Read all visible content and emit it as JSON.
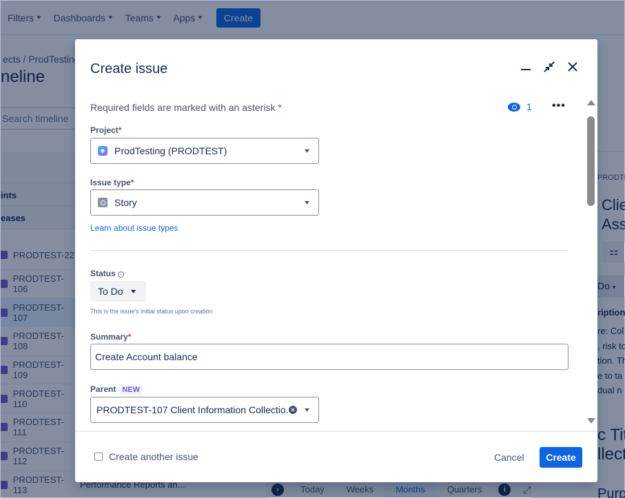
{
  "topnav": {
    "items": [
      {
        "label": "Filters"
      },
      {
        "label": "Dashboards"
      },
      {
        "label": "Teams"
      },
      {
        "label": "Apps"
      }
    ],
    "create_label": "Create"
  },
  "background": {
    "breadcrumb": "ects  /  ProdTesting",
    "page_title": "neline",
    "search_placeholder": "Search timeline",
    "sprints_label": "ints",
    "releases_label": "eases",
    "issues": [
      {
        "key": "PRODTEST-22"
      },
      {
        "key": "PRODTEST-106"
      },
      {
        "key": "PRODTEST-107"
      },
      {
        "key": "PRODTEST-108"
      },
      {
        "key": "PRODTEST-109"
      },
      {
        "key": "PRODTEST-110"
      },
      {
        "key": "PRODTEST-111"
      },
      {
        "key": "PRODTEST-112"
      },
      {
        "key": "PRODTEST-113"
      }
    ],
    "last_issue_title": "Performance Reports an...",
    "timeline_toolbar": {
      "today": "Today",
      "weeks": "Weeks",
      "months": "Months",
      "quarters": "Quarters",
      "active": "Months"
    },
    "detail_panel": {
      "key": "PRODTEST",
      "title_line1": "Clie",
      "title_line2": "Ass",
      "status": "Do",
      "description_label": "ription",
      "description_lines": [
        "re: Col",
        ", risk to",
        "tion. Th",
        "e to ta",
        "dual n"
      ],
      "heading_line1": "c Tit",
      "heading_line2": "llect",
      "purpose": "Purpose"
    }
  },
  "modal": {
    "title": "Create issue",
    "required_note": "Required fields are marked with an asterisk",
    "watchers_count": "1",
    "fields": {
      "project": {
        "label": "Project",
        "value": "ProdTesting (PRODTEST)"
      },
      "issue_type": {
        "label": "Issue type",
        "value": "Story",
        "help_link": "Learn about issue types"
      },
      "status": {
        "label": "Status",
        "value": "To Do",
        "help": "This is the issue's initial status upon creation"
      },
      "summary": {
        "label": "Summary",
        "value": "Create Account balance"
      },
      "parent": {
        "label": "Parent",
        "badge": "NEW",
        "value": "PRODTEST-107 Client Information Collectio..."
      }
    },
    "footer": {
      "create_another_label": "Create another issue",
      "create_another_checked": false,
      "cancel_label": "Cancel",
      "create_label": "Create"
    }
  },
  "colors": {
    "primary": "#0c66e4",
    "required": "#de350b",
    "overlay": "rgba(9,30,66,0.5)"
  }
}
